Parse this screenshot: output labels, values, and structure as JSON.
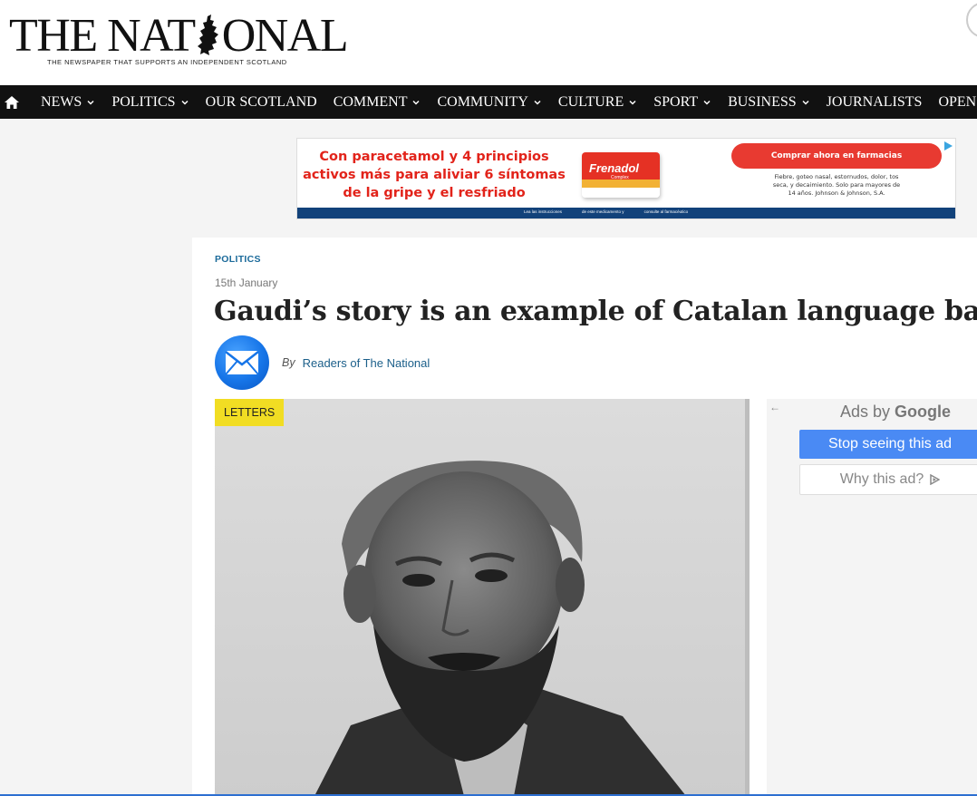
{
  "masthead": {
    "logo_left": "THE NAT",
    "logo_right": "ONAL",
    "tagline": "THE NEWSPAPER THAT SUPPORTS AN INDEPENDENT SCOTLAND"
  },
  "nav": {
    "home_icon": "home-icon",
    "items": [
      {
        "label": "NEWS",
        "has_dropdown": true
      },
      {
        "label": "POLITICS",
        "has_dropdown": true
      },
      {
        "label": "OUR SCOTLAND",
        "has_dropdown": false
      },
      {
        "label": "COMMENT",
        "has_dropdown": true
      },
      {
        "label": "COMMUNITY",
        "has_dropdown": true
      },
      {
        "label": "CULTURE",
        "has_dropdown": true
      },
      {
        "label": "SPORT",
        "has_dropdown": true
      },
      {
        "label": "BUSINESS",
        "has_dropdown": true
      },
      {
        "label": "JOURNALISTS",
        "has_dropdown": false
      },
      {
        "label": "OPEN M",
        "has_dropdown": false
      }
    ]
  },
  "banner_ad": {
    "text": "Con paracetamol y 4 principios activos más para aliviar 6 síntomas de la gripe y el resfriado",
    "product": "Frenadol",
    "product_sub": "Complex",
    "cta": "Comprar ahora en farmacias",
    "small_print": "Fiebre, goteo nasal, estornudos, dolor, tos seca, y decaimiento. Solo para mayores de 14 años. Johnson & Johnson, S.A.",
    "footer_items": [
      "Lea las instrucciones",
      "de este medicamento y",
      "consulte al farmacéutico"
    ]
  },
  "article": {
    "category": "POLITICS",
    "date": "15th January",
    "headline": "Gaudi’s story is an example of Catalan language battle",
    "by": "By",
    "author": "Readers of The National",
    "tag": "LETTERS"
  },
  "side_ad": {
    "back_arrow": "←",
    "ads_by": "Ads by",
    "google": "Google",
    "stop_label": "Stop seeing this ad",
    "why_label": "Why this ad?"
  },
  "colors": {
    "nav_bg": "#111111",
    "category": "#1b6a9a",
    "tag_bg": "#f1dd23",
    "stop_btn": "#4a8af4",
    "ad_red": "#e2231a"
  }
}
